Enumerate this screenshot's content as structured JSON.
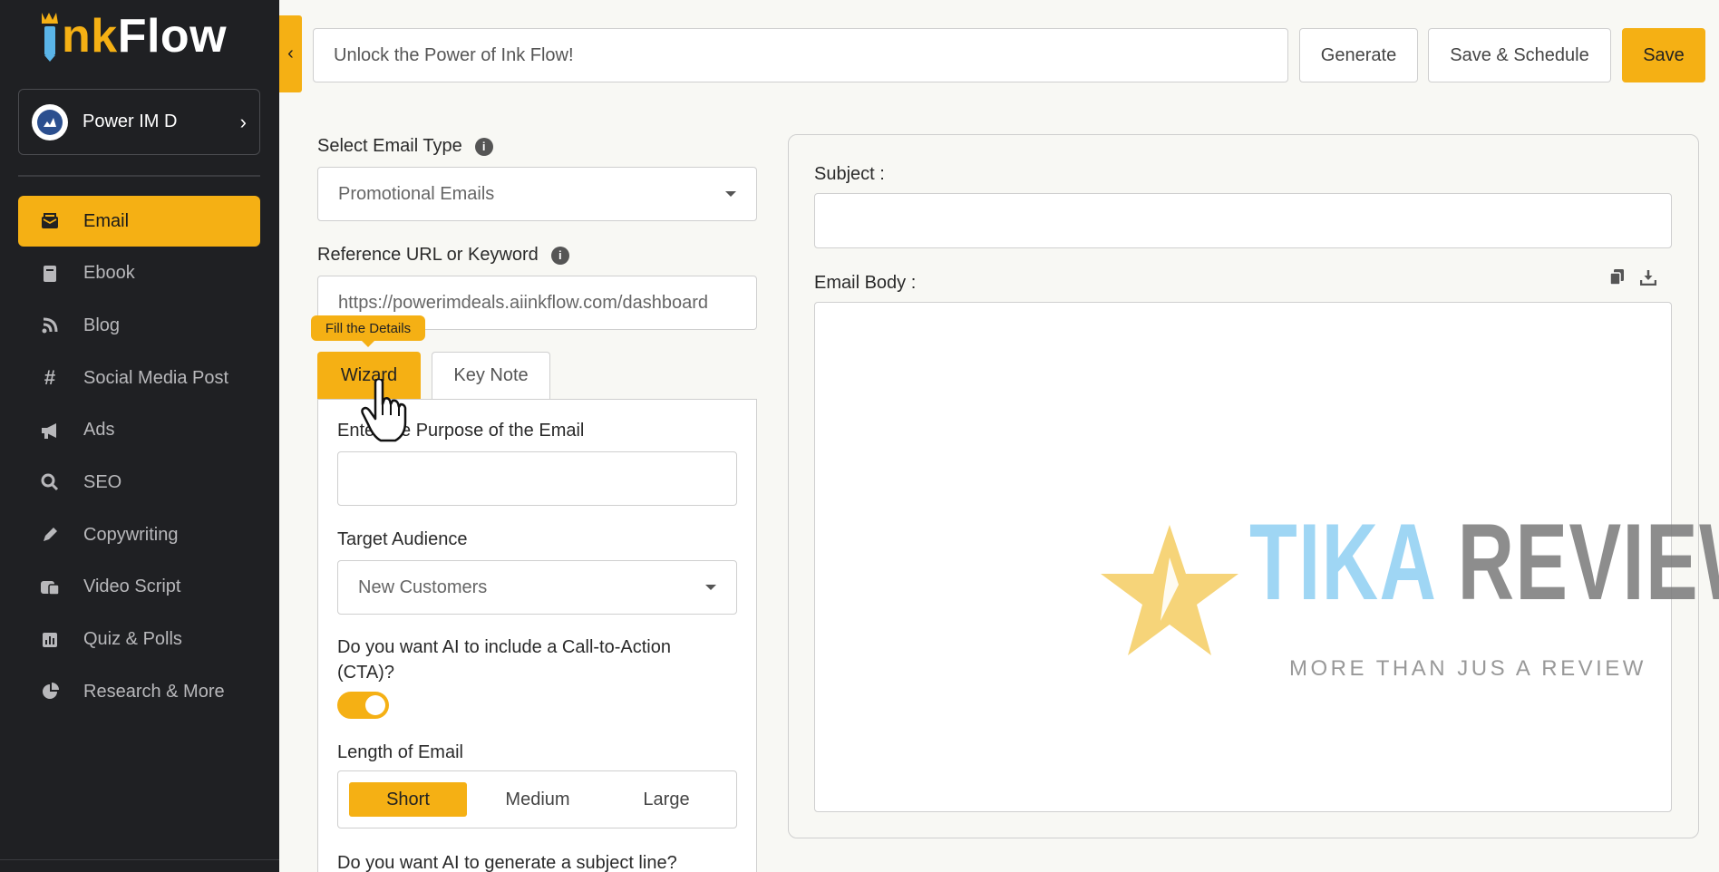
{
  "app": {
    "logo_prefix": "ı",
    "logo_ink": "nk",
    "logo_flow": "Flow"
  },
  "workspace": {
    "name": "Power IM D"
  },
  "sidebar": {
    "items": [
      {
        "label": "Email",
        "icon": "mail-icon",
        "active": true
      },
      {
        "label": "Ebook",
        "icon": "book-icon"
      },
      {
        "label": "Blog",
        "icon": "blog-icon"
      },
      {
        "label": "Social Media Post",
        "icon": "hashtag-icon"
      },
      {
        "label": "Ads",
        "icon": "megaphone-icon"
      },
      {
        "label": "SEO",
        "icon": "search-icon"
      },
      {
        "label": "Copywriting",
        "icon": "pen-icon"
      },
      {
        "label": "Video Script",
        "icon": "script-icon"
      },
      {
        "label": "Quiz & Polls",
        "icon": "chart-icon"
      },
      {
        "label": "Research & More",
        "icon": "pie-icon"
      }
    ]
  },
  "topbar": {
    "title_value": "Unlock the Power of Ink Flow!",
    "generate_label": "Generate",
    "schedule_label": "Save & Schedule",
    "save_label": "Save"
  },
  "form": {
    "email_type_label": "Select Email Type",
    "email_type_value": "Promotional Emails",
    "reference_label": "Reference URL or Keyword",
    "reference_value": "https://powerimdeals.aiinkflow.com/dashboard",
    "tooltip": "Fill the Details",
    "tabs": {
      "wizard": "Wizard",
      "key_note": "Key Note"
    },
    "purpose_label": "Enter the Purpose of the Email",
    "purpose_value": "",
    "audience_label": "Target Audience",
    "audience_value": "New Customers",
    "cta_label_line1": "Do you want AI to include a Call-to-Action",
    "cta_label_line2": "(CTA)?",
    "cta_enabled": true,
    "length_label": "Length of Email",
    "length_options": [
      "Short",
      "Medium",
      "Large"
    ],
    "length_selected": "Short",
    "subject_question": "Do you want AI to generate a subject line?"
  },
  "output": {
    "subject_label": "Subject :",
    "subject_value": "",
    "body_label": "Email Body :",
    "body_value": ""
  },
  "watermark": {
    "word1": "TIKA",
    "word2": "REVIEW",
    "tagline": "MORE THAN JUS A REVIEW"
  },
  "colors": {
    "accent": "#f5b014",
    "sidebar_bg": "#1f2023",
    "page_bg": "#f8f8f4"
  }
}
